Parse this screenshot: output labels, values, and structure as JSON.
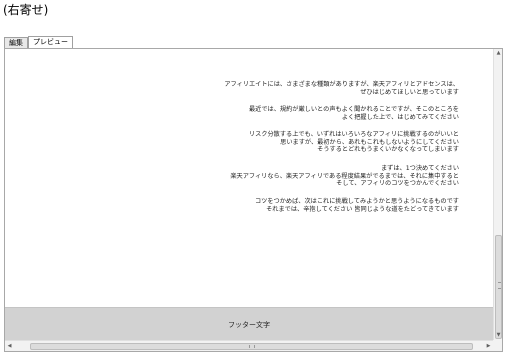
{
  "caption": "(右寄せ)",
  "tabs": [
    {
      "label": "編集",
      "active": false
    },
    {
      "label": "プレビュー",
      "active": true
    }
  ],
  "content": {
    "paragraphs": [
      [
        "アフィリエイトには、さまざまな種類がありますが、楽天アフィリとアドセンスは、",
        "ぜひはじめてほしいと思っています"
      ],
      [
        "最近では、規約が厳しいとの声もよく聞かれることですが、そこのところを",
        "よく把握した上で、はじめてみてください"
      ],
      [
        "リスク分散する上でも、いずれはいろいろなアフィリに挑戦するのがいいと",
        "思いますが、最初から、あれもこれもしないようにしてください",
        "そうするとどれもうまくいかなくなってしまいます"
      ],
      [
        "まずは、1つ決めてください",
        "楽天アフィリなら、楽天アフィリである程度結果がでるまでは、それに集中すると",
        "そして、アフィリのコツをつかんでください"
      ],
      [
        "コツをつかめば、次はこれに挑戦してみようかと思うようになるものです",
        "それまでは、辛抱してください 皆同じような道をたどってきています"
      ]
    ]
  },
  "footer": {
    "text": "フッター文字"
  },
  "scrollbars": {
    "up_arrow": "▲",
    "down_arrow": "▼",
    "left_arrow": "◀",
    "right_arrow": "▶",
    "v_grip": "≡",
    "h_grip": "III"
  }
}
